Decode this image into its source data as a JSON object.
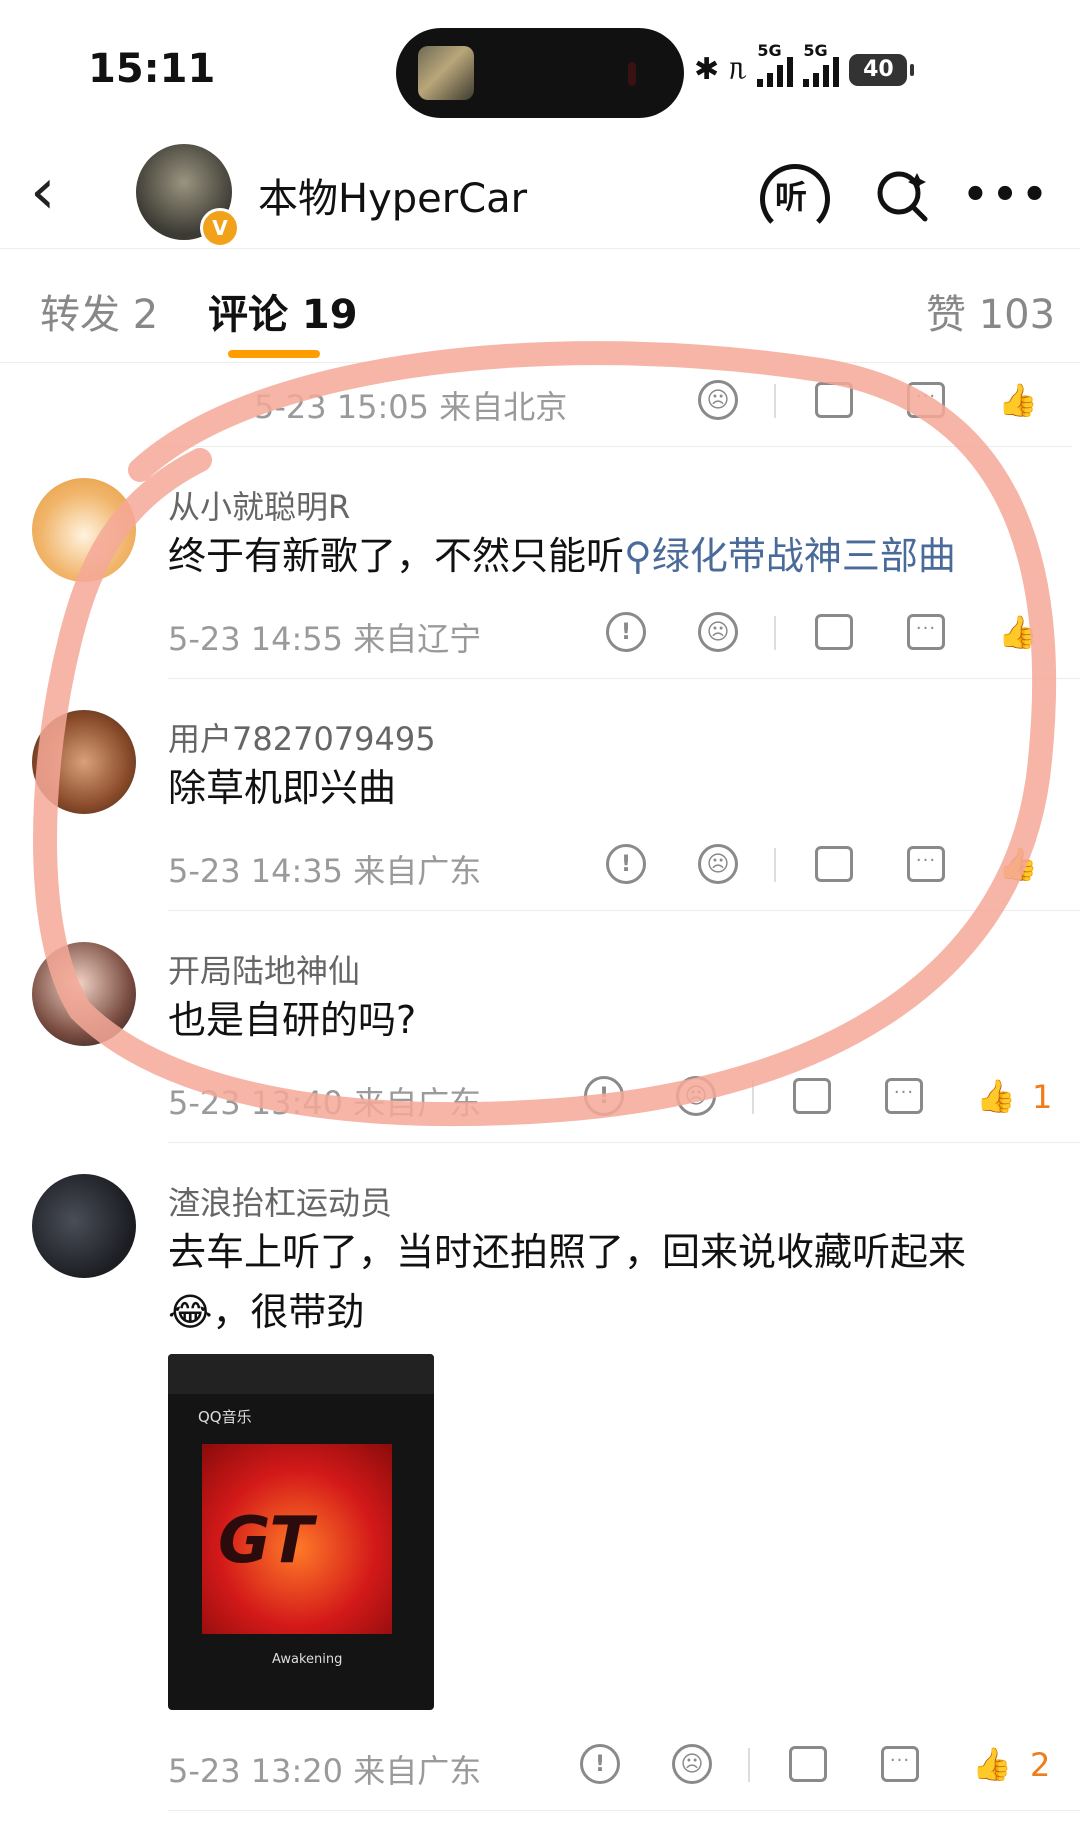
{
  "status_bar": {
    "time": "15:11",
    "network_1": "5G",
    "network_2": "5G",
    "battery": "40"
  },
  "header": {
    "title": "本物HyperCar",
    "listen_label": "听"
  },
  "tabs": {
    "repost": "转发 2",
    "comment": "评论 19",
    "like": "赞 103"
  },
  "top_meta": {
    "time": "5-23 15:05 来自北京"
  },
  "comments": [
    {
      "name": "从小就聪明R",
      "text": "终于有新歌了，不然只能听",
      "link": "绿化带战神三部曲",
      "meta": "5-23 14:55 来自辽宁",
      "likes": ""
    },
    {
      "name": "用户7827079495",
      "text": "除草机即兴曲",
      "meta": "5-23 14:35 来自广东",
      "likes": ""
    },
    {
      "name": "开局陆地神仙",
      "text": "也是自研的吗?",
      "meta": "5-23 13:40 来自广东",
      "likes": "1"
    },
    {
      "name": "渣浪抬杠运动员",
      "text": "去车上听了，当时还拍照了，回来说收藏听起来",
      "text2": "，很带劲",
      "emoji": "😂",
      "meta": "5-23 13:20 来自广东",
      "likes": "2",
      "photo": {
        "app": "QQ音乐",
        "album": "GT",
        "caption": "Awakening"
      }
    }
  ],
  "colors": {
    "accent": "#ff9c00",
    "link": "#4a6b9a",
    "liked": "#f07b1a",
    "annotation": "#f4a898"
  }
}
